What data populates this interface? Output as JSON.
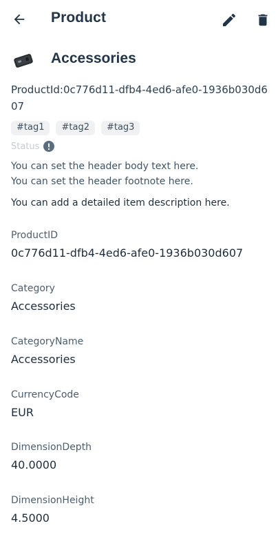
{
  "header": {
    "title": "Product",
    "back_icon": "arrow-left-icon",
    "edit_icon": "pencil-icon",
    "delete_icon": "trash-icon"
  },
  "product": {
    "name": "Accessories",
    "thumbnail_icon": "product-thumbnail",
    "subtitle": "ProductId:0c776d11-dfb4-4ed6-afe0-1936b030d607",
    "tags": [
      "#tag1",
      "#tag2",
      "#tag3"
    ],
    "status_label": "Status",
    "status_icon": "info-circle-icon",
    "header_body": "You can set the header body text here.",
    "header_footnote": "You can set the header footnote here.",
    "description": "You can add a detailed item description here."
  },
  "fields": [
    {
      "label": "ProductID",
      "value": "0c776d11-dfb4-4ed6-afe0-1936b030d607"
    },
    {
      "label": "Category",
      "value": "Accessories"
    },
    {
      "label": "CategoryName",
      "value": "Accessories"
    },
    {
      "label": "CurrencyCode",
      "value": "EUR"
    },
    {
      "label": "DimensionDepth",
      "value": "40.0000"
    },
    {
      "label": "DimensionHeight",
      "value": "4.5000"
    }
  ],
  "colors": {
    "title": "#223548",
    "status_icon": "#5b6d7e",
    "tag_bg": "#eff1f2"
  }
}
